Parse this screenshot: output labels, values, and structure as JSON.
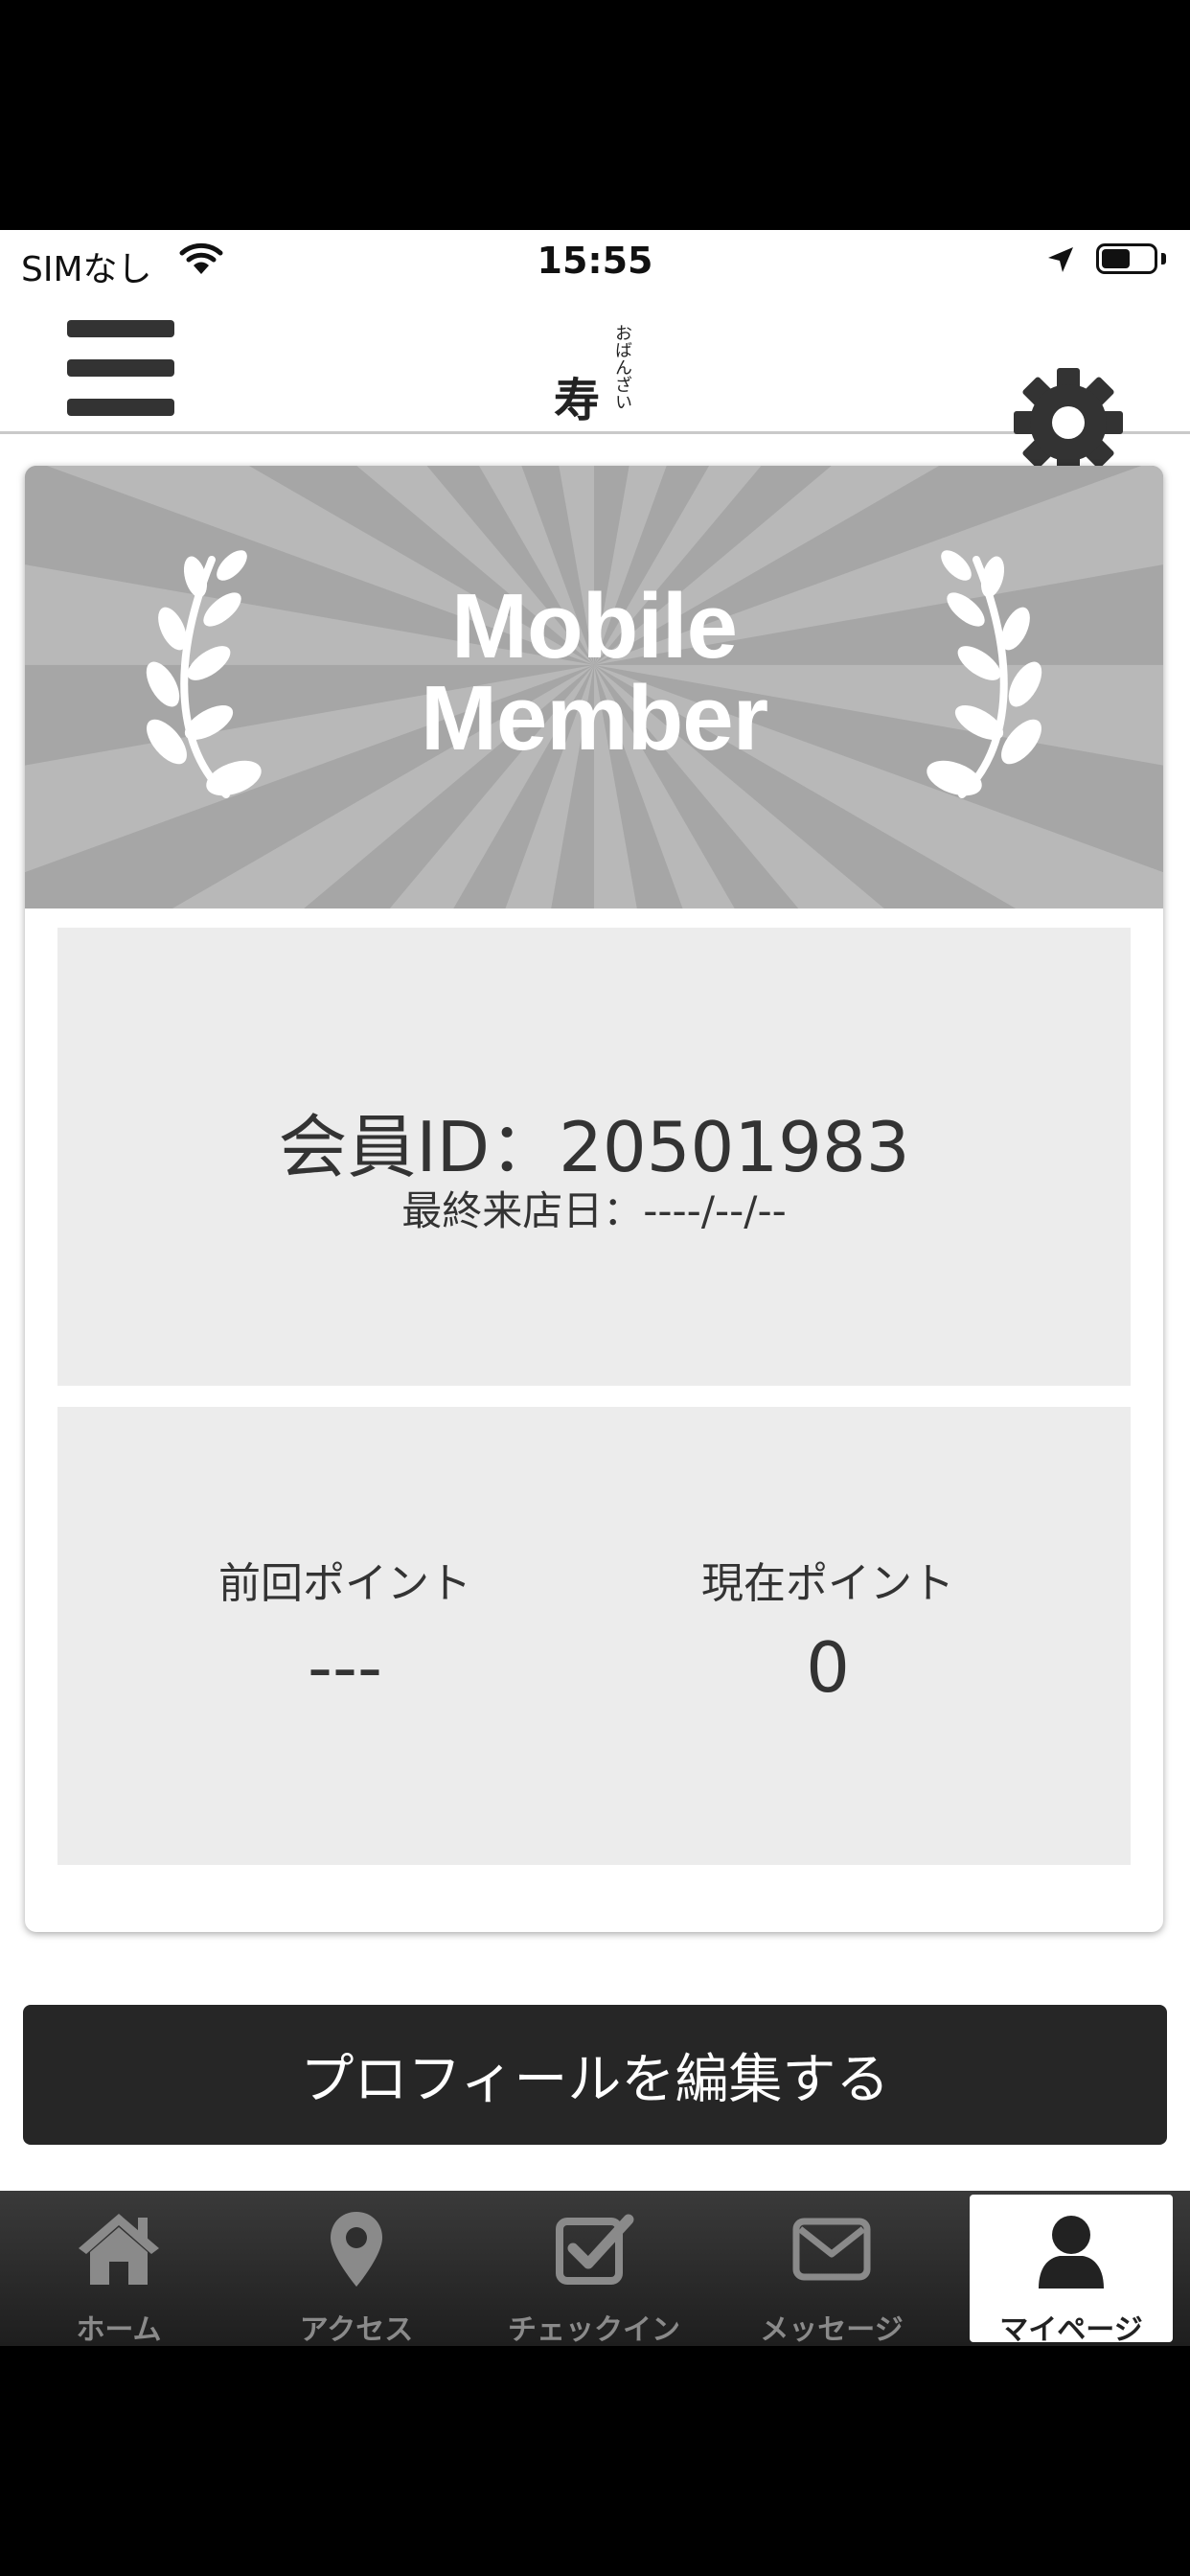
{
  "status_bar": {
    "carrier": "SIMなし",
    "time": "15:55",
    "battery_level": 0.55
  },
  "header": {
    "logo_main": "寿",
    "logo_sub": "おばんざい"
  },
  "member_card": {
    "banner_line1": "Mobile",
    "banner_line2": "Member",
    "member_id_line": "会員ID：20501983",
    "last_visit_line": "最終来店日：----/--/--",
    "previous_points_label": "前回ポイント",
    "previous_points_value": "---",
    "current_points_label": "現在ポイント",
    "current_points_value": "0"
  },
  "edit_profile_label": "プロフィールを編集する",
  "tabs": [
    {
      "label": "ホーム",
      "icon": "home-icon"
    },
    {
      "label": "アクセス",
      "icon": "map-pin-icon"
    },
    {
      "label": "チェックイン",
      "icon": "checkbox-icon"
    },
    {
      "label": "メッセージ",
      "icon": "envelope-icon"
    },
    {
      "label": "マイページ",
      "icon": "user-icon",
      "active": true
    }
  ],
  "colors": {
    "banner_bg": "#aaaaaa",
    "button_bg": "#262626",
    "panel_bg": "#ececec",
    "tabbar_bg": "#2e2e2e"
  }
}
